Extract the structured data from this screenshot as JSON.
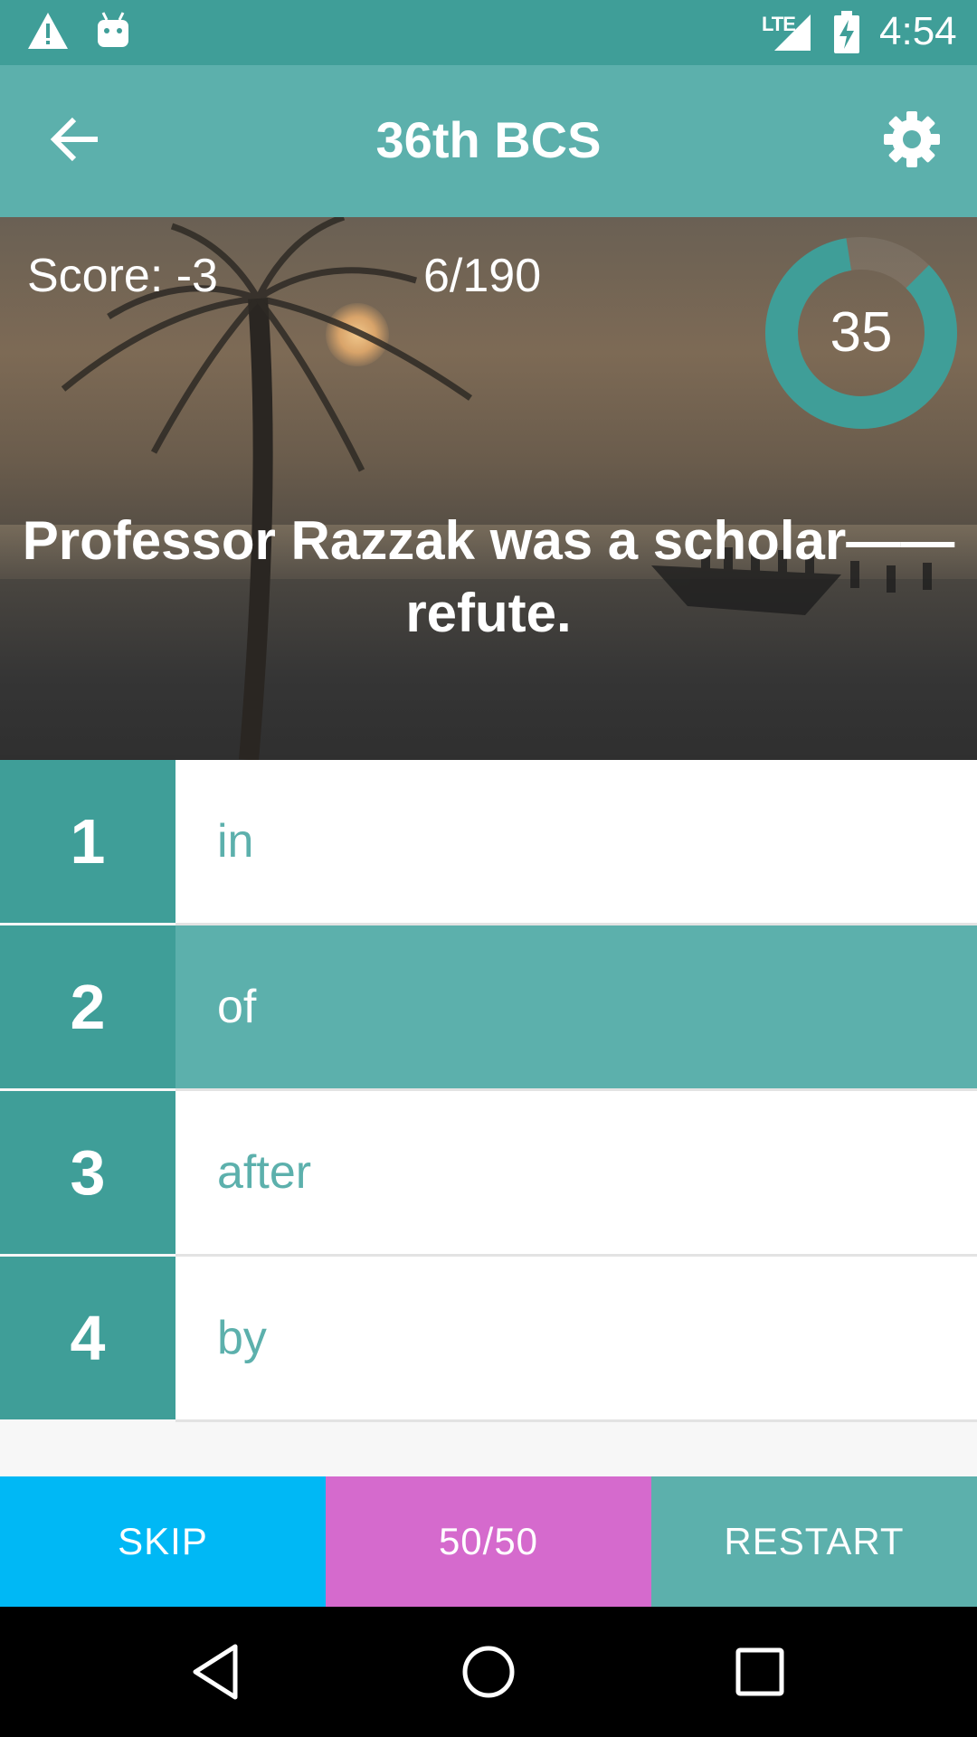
{
  "status_bar": {
    "network": "LTE",
    "time": "4:54",
    "icons": [
      "warning-icon",
      "android-debug-icon",
      "signal-icon",
      "battery-charging-icon"
    ]
  },
  "app_bar": {
    "title": "36th BCS",
    "back_icon": "arrow-left-icon",
    "settings_icon": "gear-icon"
  },
  "quiz": {
    "score": "Score: -3",
    "progress": "6/190",
    "timer": "35",
    "timer_fraction": 0.85,
    "question": "Professor Razzak was a scholar——refute."
  },
  "options": [
    {
      "number": "1",
      "text": "in",
      "selected": false
    },
    {
      "number": "2",
      "text": "of",
      "selected": true
    },
    {
      "number": "3",
      "text": "after",
      "selected": false
    },
    {
      "number": "4",
      "text": "by",
      "selected": false
    }
  ],
  "actions": {
    "skip": "SKIP",
    "fifty_fifty": "50/50",
    "restart": "RESTART"
  },
  "colors": {
    "status_bar": "#3f9e98",
    "app_bar": "#5cb0ac",
    "option_number": "#3f9e98",
    "selected_option": "#5cb0ac",
    "skip": "#00b8f5",
    "fifty_fifty": "#d56acd",
    "restart": "#5cb0ac"
  }
}
